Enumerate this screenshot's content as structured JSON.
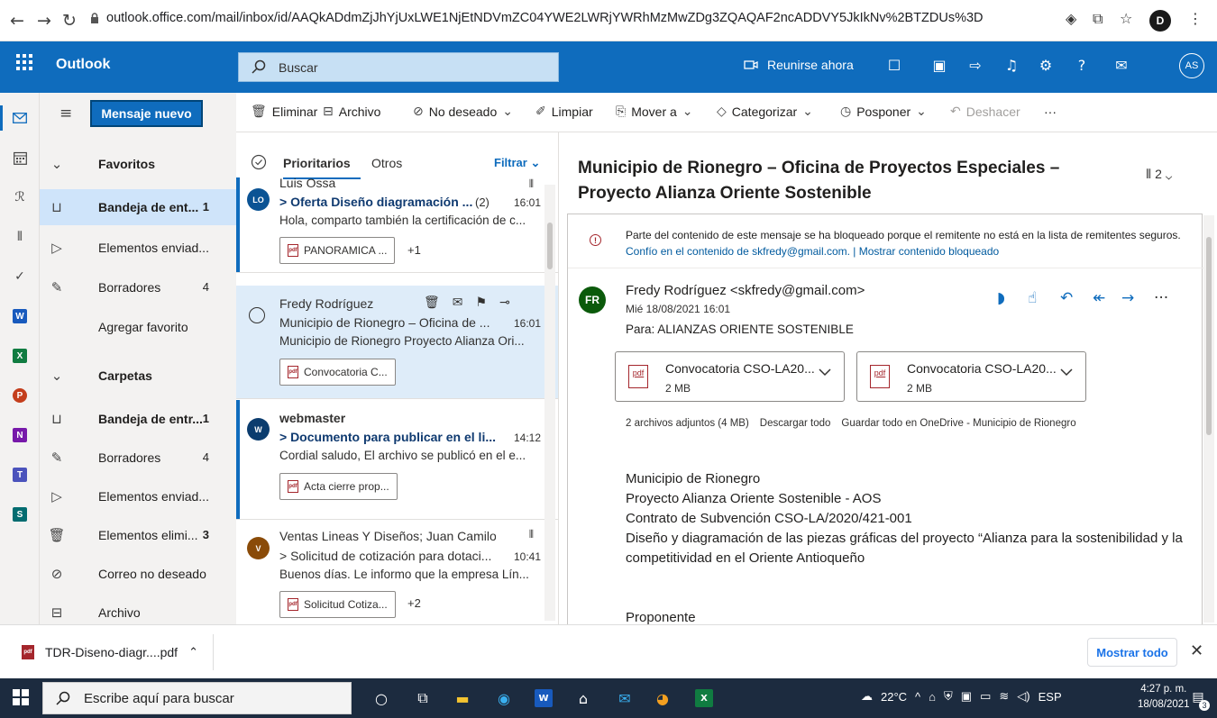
{
  "browser": {
    "url": "outlook.office.com/mail/inbox/id/AAQkADdmZjJhYjUxLWE1NjEtNDVmZC04YWE2LWRjYWRhMzMwZDg3ZQAQAF2ncADDVY5JkIkNv%2BTZDUs%3D",
    "profile_initial": "D"
  },
  "suite": {
    "app_name": "Outlook",
    "search_placeholder": "Buscar",
    "meet_now": "Reunirse ahora",
    "user_initials": "AS"
  },
  "new_mail": "Mensaje nuevo",
  "toolbar": {
    "delete": "Eliminar",
    "archive": "Archivo",
    "junk": "No deseado",
    "sweep": "Limpiar",
    "move": "Mover a",
    "categorize": "Categorizar",
    "snooze": "Posponer",
    "undo": "Deshacer",
    "more": "···"
  },
  "folders": {
    "favorites_header": "Favoritos",
    "favorites": [
      {
        "label": "Bandeja de ent...",
        "count": "1"
      },
      {
        "label": "Elementos enviad...",
        "count": ""
      },
      {
        "label": "Borradores",
        "count": "4"
      },
      {
        "label": "Agregar favorito",
        "count": ""
      }
    ],
    "folders_header": "Carpetas",
    "folders": [
      {
        "label": "Bandeja de entr...",
        "count": "1"
      },
      {
        "label": "Borradores",
        "count": "4"
      },
      {
        "label": "Elementos enviad...",
        "count": ""
      },
      {
        "label": "Elementos elimi...",
        "count": "3"
      },
      {
        "label": "Correo no deseado",
        "count": ""
      },
      {
        "label": "Archivo",
        "count": ""
      }
    ]
  },
  "list": {
    "focused": "Prioritarios",
    "other": "Otros",
    "filter": "Filtrar",
    "messages": [
      {
        "initials": "LO",
        "avatar_color": "#0b5394",
        "sender": "Luis Ossa",
        "subject": "> Oferta Diseño diagramación ...",
        "thread": "(2)",
        "time": "16:01",
        "preview": "Hola, comparto también la certificación de c...",
        "attachment": "PANORAMICA ...",
        "more": "+1"
      },
      {
        "initials": "",
        "avatar_color": "",
        "sender": "Fredy Rodríguez",
        "subject": "Municipio de Rionegro – Oficina de ...",
        "thread": "",
        "time": "16:01",
        "preview": "Municipio de Rionegro Proyecto Alianza Ori...",
        "attachment": "Convocatoria C...",
        "more": ""
      },
      {
        "initials": "W",
        "avatar_color": "#0b3c6e",
        "sender": "webmaster",
        "subject": "> Documento para publicar en el li...",
        "thread": "",
        "time": "14:12",
        "preview": "Cordial saludo, El archivo se publicó en el e...",
        "attachment": "Acta cierre prop...",
        "more": ""
      },
      {
        "initials": "V",
        "avatar_color": "#8a4b08",
        "sender": "Ventas Lineas Y Diseños; Juan Camilo ...",
        "subject": "> Solicitud de cotización para dotaci...",
        "thread": "",
        "time": "10:41",
        "preview": "Buenos días. Le informo que la empresa Lín...",
        "attachment": "Solicitud Cotiza...",
        "more": "+2"
      }
    ]
  },
  "reading": {
    "subject": "Municipio de Rionegro – Oficina de Proyectos Especiales – Proyecto Alianza Oriente Sostenible",
    "attachment_count": "2",
    "notice_line1": "Parte del contenido de este mensaje se ha bloqueado porque el remitente no está en la lista de remitentes seguros.",
    "notice_line2": "Confío en el contenido de skfredy@gmail.com. | Mostrar contenido bloqueado",
    "sender_initials": "FR",
    "from": "Fredy Rodríguez <skfredy@gmail.com>",
    "date": "Mié 18/08/2021 16:01",
    "to": "Para:  ALIANZAS ORIENTE SOSTENIBLE",
    "attachments": [
      {
        "name": "Convocatoria CSO-LA20...",
        "size": "2 MB"
      },
      {
        "name": "Convocatoria CSO-LA20...",
        "size": "2 MB"
      }
    ],
    "attach_summary": "2 archivos adjuntos (4 MB)",
    "download_all": "Descargar todo",
    "save_onedrive": "Guardar todo en OneDrive - Municipio de Rionegro",
    "body": [
      "Municipio de Rionegro",
      "Proyecto Alianza Oriente Sostenible - AOS",
      "Contrato de Subvención CSO-LA/2020/421-001",
      "Diseño y diagramación de las piezas gráficas del proyecto “Alianza para la sostenibilidad y la competitividad en el Oriente Antioqueño",
      "",
      "",
      "Proponente"
    ]
  },
  "downloads": {
    "file": "TDR-Diseno-diagr....pdf",
    "show_all": "Mostrar todo"
  },
  "taskbar": {
    "search_placeholder": "Escribe aquí para buscar",
    "temperature": "22°C",
    "language": "ESP",
    "time": "4:27 p. m.",
    "date": "18/08/2021",
    "notifications": "3"
  }
}
